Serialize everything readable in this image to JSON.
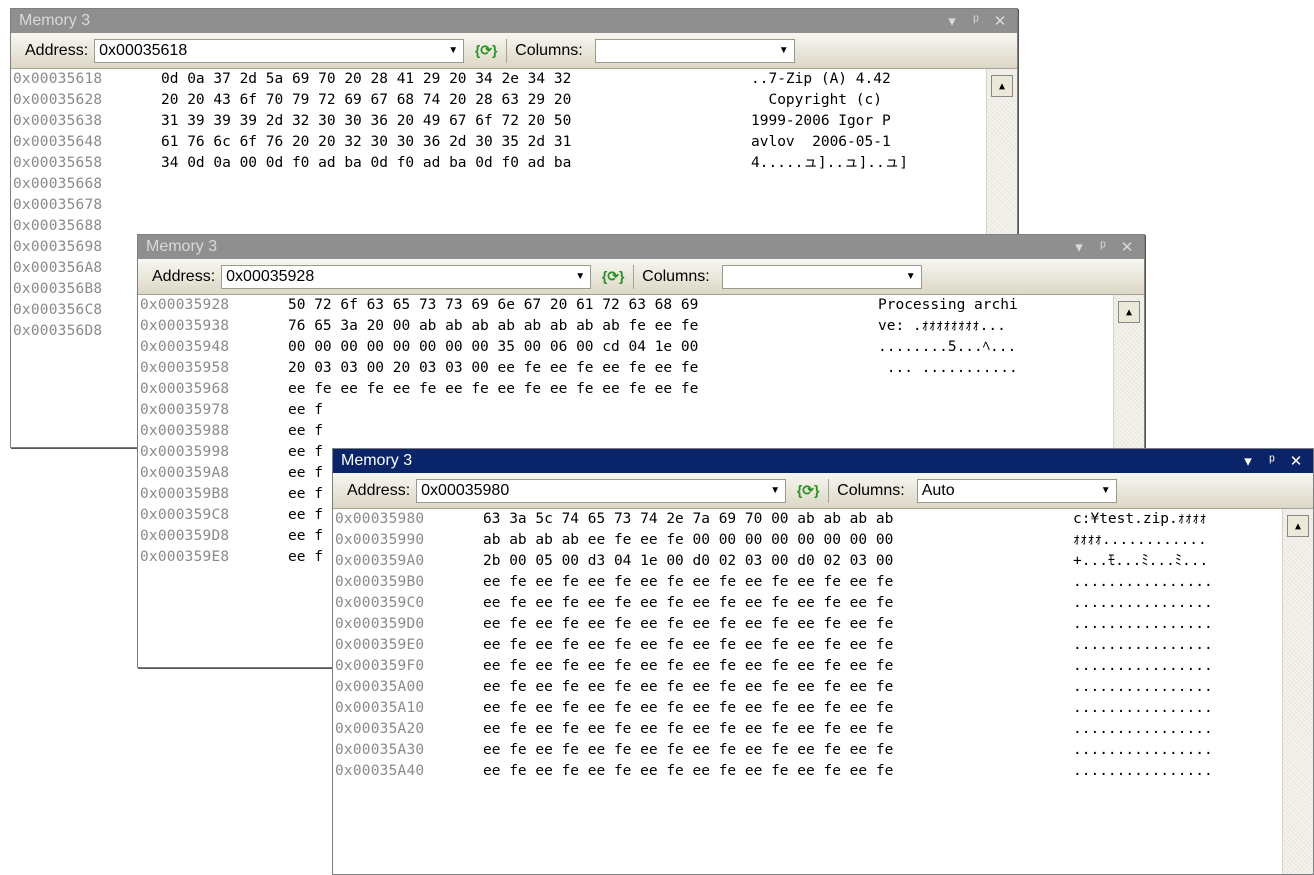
{
  "windows": [
    {
      "title": "Memory 3",
      "address_label": "Address:",
      "address_value": "0x00035618",
      "columns_label": "Columns:",
      "columns_value": "",
      "rows": [
        {
          "addr": "0x00035618",
          "hex": "0d 0a 37 2d 5a 69 70 20 28 41 29 20 34 2e 34 32",
          "ascii": "..7-Zip (A) 4.42"
        },
        {
          "addr": "0x00035628",
          "hex": "20 20 43 6f 70 79 72 69 67 68 74 20 28 63 29 20",
          "ascii": "  Copyright (c) "
        },
        {
          "addr": "0x00035638",
          "hex": "31 39 39 39 2d 32 30 30 36 20 49 67 6f 72 20 50",
          "ascii": "1999-2006 Igor P"
        },
        {
          "addr": "0x00035648",
          "hex": "61 76 6c 6f 76 20 20 32 30 30 36 2d 30 35 2d 31",
          "ascii": "avlov  2006-05-1"
        },
        {
          "addr": "0x00035658",
          "hex": "34 0d 0a 00 0d f0 ad ba 0d f0 ad ba 0d f0 ad ba",
          "ascii": "4.....ュ]..ュ]..ュ]"
        },
        {
          "addr": "0x00035668",
          "hex": "",
          "ascii": ""
        },
        {
          "addr": "0x00035678",
          "hex": "",
          "ascii": ""
        },
        {
          "addr": "0x00035688",
          "hex": "",
          "ascii": ""
        },
        {
          "addr": "0x00035698",
          "hex": "",
          "ascii": ""
        },
        {
          "addr": "0x000356A8",
          "hex": "",
          "ascii": ""
        },
        {
          "addr": "0x000356B8",
          "hex": "",
          "ascii": ""
        },
        {
          "addr": "0x000356C8",
          "hex": "",
          "ascii": ""
        },
        {
          "addr": "0x000356D8",
          "hex": "",
          "ascii": ""
        }
      ]
    },
    {
      "title": "Memory 3",
      "address_label": "Address:",
      "address_value": "0x00035928",
      "columns_label": "Columns:",
      "columns_value": "",
      "rows": [
        {
          "addr": "0x00035928",
          "hex": "50 72 6f 63 65 73 73 69 6e 67 20 61 72 63 68 69",
          "ascii": "Processing archi"
        },
        {
          "addr": "0x00035938",
          "hex": "76 65 3a 20 00 ab ab ab ab ab ab ab ab fe ee fe",
          "ascii": "ve: .ｫｫｫｫｫｫｫｫ..."
        },
        {
          "addr": "0x00035948",
          "hex": "00 00 00 00 00 00 00 00 35 00 06 00 cd 04 1e 00",
          "ascii": "........5...ﾍ..."
        },
        {
          "addr": "0x00035958",
          "hex": "20 03 03 00 20 03 03 00 ee fe ee fe ee fe ee fe",
          "ascii": " ... ..........."
        },
        {
          "addr": "0x00035968",
          "hex": "ee fe ee fe ee fe ee fe ee fe ee fe ee fe ee fe",
          "ascii": ""
        },
        {
          "addr": "0x00035978",
          "hex": "ee f",
          "ascii": ""
        },
        {
          "addr": "0x00035988",
          "hex": "ee f",
          "ascii": ""
        },
        {
          "addr": "0x00035998",
          "hex": "ee f",
          "ascii": ""
        },
        {
          "addr": "0x000359A8",
          "hex": "ee f",
          "ascii": ""
        },
        {
          "addr": "0x000359B8",
          "hex": "ee f",
          "ascii": ""
        },
        {
          "addr": "0x000359C8",
          "hex": "ee f",
          "ascii": ""
        },
        {
          "addr": "0x000359D8",
          "hex": "ee f",
          "ascii": ""
        },
        {
          "addr": "0x000359E8",
          "hex": "ee f",
          "ascii": ""
        }
      ]
    },
    {
      "title": "Memory 3",
      "address_label": "Address:",
      "address_value": "0x00035980",
      "columns_label": "Columns:",
      "columns_value": "Auto",
      "rows": [
        {
          "addr": "0x00035980",
          "hex": "63 3a 5c 74 65 73 74 2e 7a 69 70 00 ab ab ab ab",
          "ascii": "c:¥test.zip.ｫｫｫｫ"
        },
        {
          "addr": "0x00035990",
          "hex": "ab ab ab ab ee fe ee fe 00 00 00 00 00 00 00 00",
          "ascii": "ｫｫｫｫ............"
        },
        {
          "addr": "0x000359A0",
          "hex": "2b 00 05 00 d3 04 1e 00 d0 02 03 00 d0 02 03 00",
          "ascii": "+...ﾓ...ﾐ...ﾐ..."
        },
        {
          "addr": "0x000359B0",
          "hex": "ee fe ee fe ee fe ee fe ee fe ee fe ee fe ee fe",
          "ascii": "................"
        },
        {
          "addr": "0x000359C0",
          "hex": "ee fe ee fe ee fe ee fe ee fe ee fe ee fe ee fe",
          "ascii": "................"
        },
        {
          "addr": "0x000359D0",
          "hex": "ee fe ee fe ee fe ee fe ee fe ee fe ee fe ee fe",
          "ascii": "................"
        },
        {
          "addr": "0x000359E0",
          "hex": "ee fe ee fe ee fe ee fe ee fe ee fe ee fe ee fe",
          "ascii": "................"
        },
        {
          "addr": "0x000359F0",
          "hex": "ee fe ee fe ee fe ee fe ee fe ee fe ee fe ee fe",
          "ascii": "................"
        },
        {
          "addr": "0x00035A00",
          "hex": "ee fe ee fe ee fe ee fe ee fe ee fe ee fe ee fe",
          "ascii": "................"
        },
        {
          "addr": "0x00035A10",
          "hex": "ee fe ee fe ee fe ee fe ee fe ee fe ee fe ee fe",
          "ascii": "................"
        },
        {
          "addr": "0x00035A20",
          "hex": "ee fe ee fe ee fe ee fe ee fe ee fe ee fe ee fe",
          "ascii": "................"
        },
        {
          "addr": "0x00035A30",
          "hex": "ee fe ee fe ee fe ee fe ee fe ee fe ee fe ee fe",
          "ascii": "................"
        },
        {
          "addr": "0x00035A40",
          "hex": "ee fe ee fe ee fe ee fe ee fe ee fe ee fe ee fe",
          "ascii": "................"
        }
      ]
    }
  ],
  "icons": {
    "dropdown": "chevron-down-icon",
    "refresh": "refresh-icon",
    "window_menu": "window-menu-icon",
    "pin": "pin-icon",
    "close": "close-icon"
  },
  "colors": {
    "active_title": "#0a246a",
    "inactive_title": "#8f8f8f",
    "address_gray": "#8a8a8a",
    "refresh_green": "#2a8f25"
  }
}
